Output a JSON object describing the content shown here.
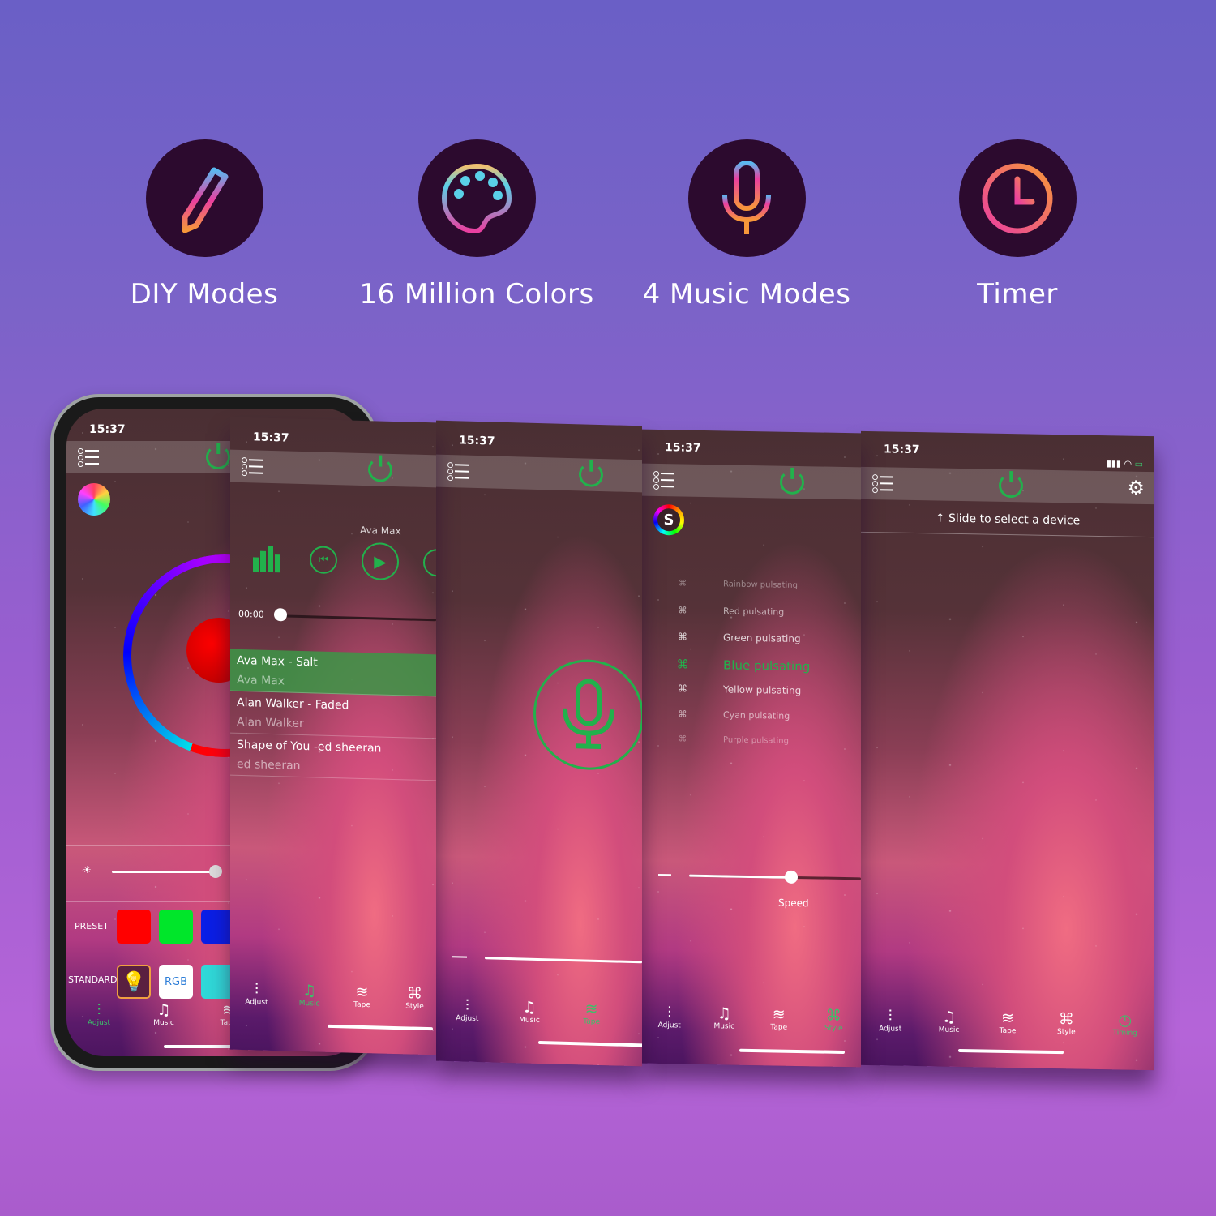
{
  "features": [
    {
      "label": "DIY Modes",
      "icon": "pencil-icon"
    },
    {
      "label": "16 Million Colors",
      "icon": "palette-icon"
    },
    {
      "label": "4 Music Modes",
      "icon": "microphone-icon"
    },
    {
      "label": "Timer",
      "icon": "clock-icon"
    }
  ],
  "status": {
    "time": "15:37"
  },
  "tabs": {
    "adjust": "Adjust",
    "music": "Music",
    "tape": "Tape",
    "style": "Style",
    "timing": "Timing"
  },
  "screen1": {
    "brightness_value": 0.8,
    "preset_label": "PRESET",
    "standard_label": "STANDARD",
    "rgb_label": "RGB",
    "preset_colors": [
      "#ff0000",
      "#00e62a",
      "#0a1ee6"
    ],
    "selected_color": "#ff0000",
    "active_tab": "Adjust"
  },
  "screen2": {
    "now_playing_artist": "Ava Max",
    "elapsed": "00:00",
    "songs": [
      {
        "title": "Ava Max - Salt",
        "artist": "Ava Max",
        "selected": true
      },
      {
        "title": "Alan Walker - Faded",
        "artist": "Alan Walker",
        "selected": false
      },
      {
        "title": "Shape of You -ed sheeran",
        "artist": "ed sheeran",
        "selected": false
      }
    ],
    "active_tab": "Music"
  },
  "screen3": {
    "active_tab": "Tape"
  },
  "screen4": {
    "styles": [
      "Rainbow pulsating",
      "Red pulsating",
      "Green pulsating",
      "Blue pulsating",
      "Yellow pulsating",
      "Cyan pulsating",
      "Purple pulsating"
    ],
    "selected_style": "Blue pulsating",
    "speed_label": "Speed",
    "speed_value": 0.7,
    "active_tab": "Style"
  },
  "screen5": {
    "hint": "↑ Slide to select a device",
    "active_tab": "Timing"
  },
  "colors": {
    "accent_green": "#22b14c",
    "feature_circle": "#2c0a2e"
  }
}
